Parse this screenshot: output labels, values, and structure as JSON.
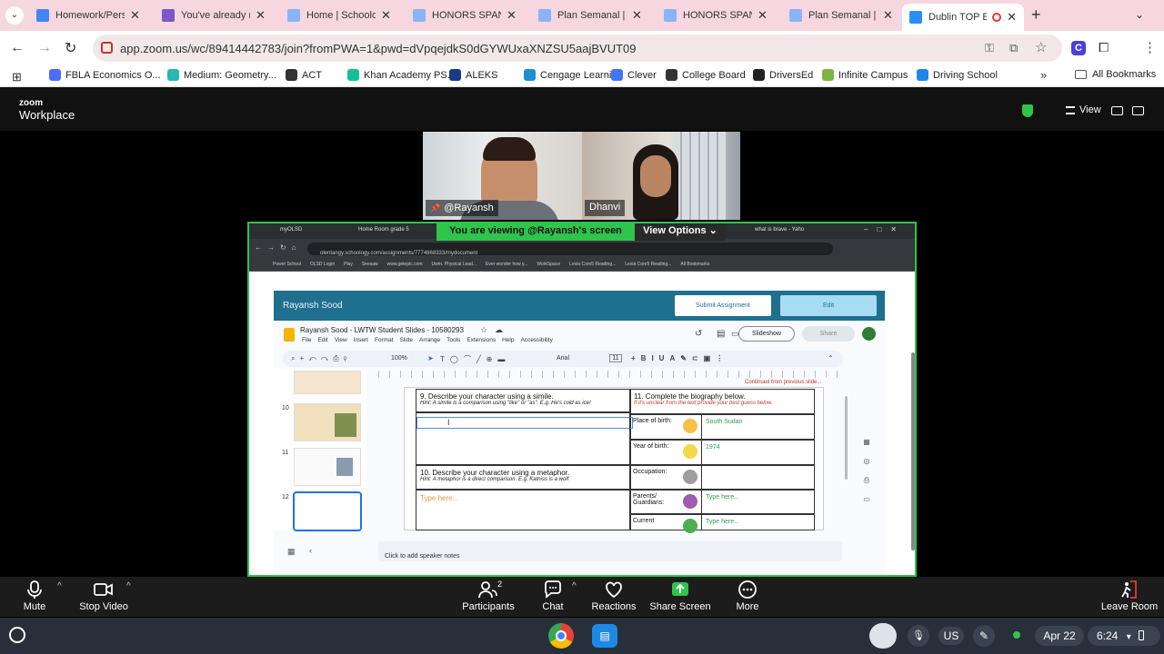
{
  "browser": {
    "tabs": [
      {
        "label": "Homework/Pers",
        "color": "#4285f4"
      },
      {
        "label": "You've already re",
        "color": "#7b57c9"
      },
      {
        "label": "Home | Schoolog",
        "color": "#8ab4f8"
      },
      {
        "label": "HONORS SPANIS",
        "color": "#8ab4f8"
      },
      {
        "label": "Plan Semanal | S",
        "color": "#8ab4f8"
      },
      {
        "label": "HONORS SPANIS",
        "color": "#8ab4f8"
      },
      {
        "label": "Plan Semanal | S",
        "color": "#8ab4f8"
      },
      {
        "label": "Dublin TOP E",
        "color": "#2d8cff"
      }
    ],
    "new_tab": "+",
    "url": "app.zoom.us/wc/89414442783/join?fromPWA=1&pwd=dVpqejdkS0dGYWUxaXNZSU5aajBVUT09",
    "bookmarks": [
      {
        "label": "FBLA Economics O...",
        "color": "#4c6ef5"
      },
      {
        "label": "Medium: Geometry...",
        "color": "#29b6b6"
      },
      {
        "label": "ACT",
        "color": "#333"
      },
      {
        "label": "Khan Academy PS...",
        "color": "#14bf96"
      },
      {
        "label": "ALEKS",
        "color": "#1a3a8a"
      },
      {
        "label": "Cengage Learning",
        "color": "#1b8fd1"
      },
      {
        "label": "Clever",
        "color": "#4274f6"
      },
      {
        "label": "College Board",
        "color": "#333"
      },
      {
        "label": "DriversEd",
        "color": "#222"
      },
      {
        "label": "Infinite Campus",
        "color": "#7cb342"
      },
      {
        "label": "Driving School",
        "color": "#1e88e5"
      }
    ],
    "bookmarks_overflow": "»",
    "all_bookmarks": "All Bookmarks"
  },
  "zoom": {
    "logo_line1": "zoom",
    "logo_line2": "Workplace",
    "view_label": "View",
    "participants": [
      {
        "name": "@Rayansh"
      },
      {
        "name": "Dhanvi"
      }
    ],
    "banner": "You are viewing  @Rayansh's screen",
    "view_options": "View Options",
    "controls": {
      "mute": "Mute",
      "stop_video": "Stop Video",
      "participants": "Participants",
      "participant_count": "2",
      "chat": "Chat",
      "reactions": "Reactions",
      "share_screen": "Share Screen",
      "more": "More",
      "leave": "Leave Room"
    }
  },
  "shared": {
    "tabs": [
      "myOLSD",
      "Home Room grade 5",
      "what is brave - Yaho"
    ],
    "url": "olentangy.schoology.com/assignments/7774868333/mydocument",
    "bookmarks": [
      "Power School",
      "OLSD Login",
      "Play",
      "Seesaw",
      "www.getepic.com",
      "Uwm. Physical Lead...",
      "Ever wonder how y...",
      "WorkSpace",
      "Lexia Core5 Reading...",
      "Lexia Core5 Reading...",
      "All Bookmarks"
    ],
    "student_name": "Rayansh Sood",
    "submit": "Submit Assignment",
    "edit": "Edit",
    "doc_title": "Rayansh Sood - LWTW Student Slides - 10580293",
    "menus": [
      "File",
      "Edit",
      "View",
      "Insert",
      "Format",
      "Slide",
      "Arrange",
      "Tools",
      "Extensions",
      "Help",
      "Accessibility"
    ],
    "slideshow": "Slideshow",
    "share": "Share",
    "zoom_level": "100%",
    "font": "Arial",
    "font_size": "11",
    "thumb_numbers": [
      "10",
      "11",
      "12"
    ],
    "continued": "Continued from previous slide...",
    "q9": "9. Describe your character using a simile.",
    "q9_hint": "Hint: A simile is a comparison using \"like\" or \"as\". E.g. He's cold as ice!",
    "q10": "10. Describe your character using a metaphor.",
    "q10_hint": "Hint: A metaphor is a direct comparison. E.g. Katniss is a wolf",
    "q10_placeholder": "Type here...",
    "q11": "11. Complete the biography below.",
    "q11_hint": "If it's unclear from the text provide your best guess below.",
    "bio": [
      {
        "label": "Place of birth:",
        "value": "South Sudan"
      },
      {
        "label": "Year of birth:",
        "value": "1974"
      },
      {
        "label": "Occupation:",
        "value": ""
      },
      {
        "label": "Parents/ Guardians:",
        "value": "Type here..."
      },
      {
        "label": "Current",
        "value": "Type here..."
      }
    ],
    "speaker_notes": "Click to add speaker notes"
  },
  "shelf": {
    "lang": "US",
    "date": "Apr 22",
    "time": "6:24"
  }
}
